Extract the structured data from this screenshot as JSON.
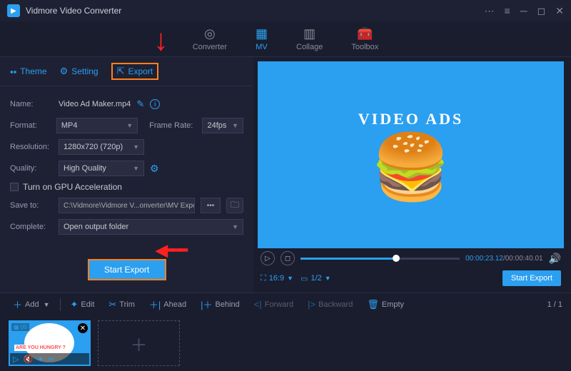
{
  "app": {
    "title": "Vidmore Video Converter"
  },
  "nav": {
    "converter": "Converter",
    "mv": "MV",
    "collage": "Collage",
    "toolbox": "Toolbox"
  },
  "tabs": {
    "theme": "Theme",
    "setting": "Setting",
    "export": "Export"
  },
  "form": {
    "name_label": "Name:",
    "name_value": "Video Ad Maker.mp4",
    "format_label": "Format:",
    "format_value": "MP4",
    "framerate_label": "Frame Rate:",
    "framerate_value": "24fps",
    "resolution_label": "Resolution:",
    "resolution_value": "1280x720 (720p)",
    "quality_label": "Quality:",
    "quality_value": "High Quality",
    "gpu_label": "Turn on GPU Acceleration",
    "saveto_label": "Save to:",
    "saveto_value": "C:\\Vidmore\\Vidmore V...onverter\\MV Exported",
    "complete_label": "Complete:",
    "complete_value": "Open output folder",
    "start_export": "Start Export"
  },
  "preview": {
    "headline": "VIDEO ADS"
  },
  "player": {
    "time_current": "00:00:23.12",
    "time_total": "00:00:40.01",
    "aspect": "16:9",
    "fraction": "1/2",
    "start_export": "Start Export"
  },
  "toolbar": {
    "add": "Add",
    "edit": "Edit",
    "trim": "Trim",
    "ahead": "Ahead",
    "behind": "Behind",
    "forward": "Forward",
    "backward": "Backward",
    "empty": "Empty",
    "page": "1 / 1"
  },
  "clip": {
    "badge": "00",
    "text": "ARE YOU HUNGRY ?"
  }
}
